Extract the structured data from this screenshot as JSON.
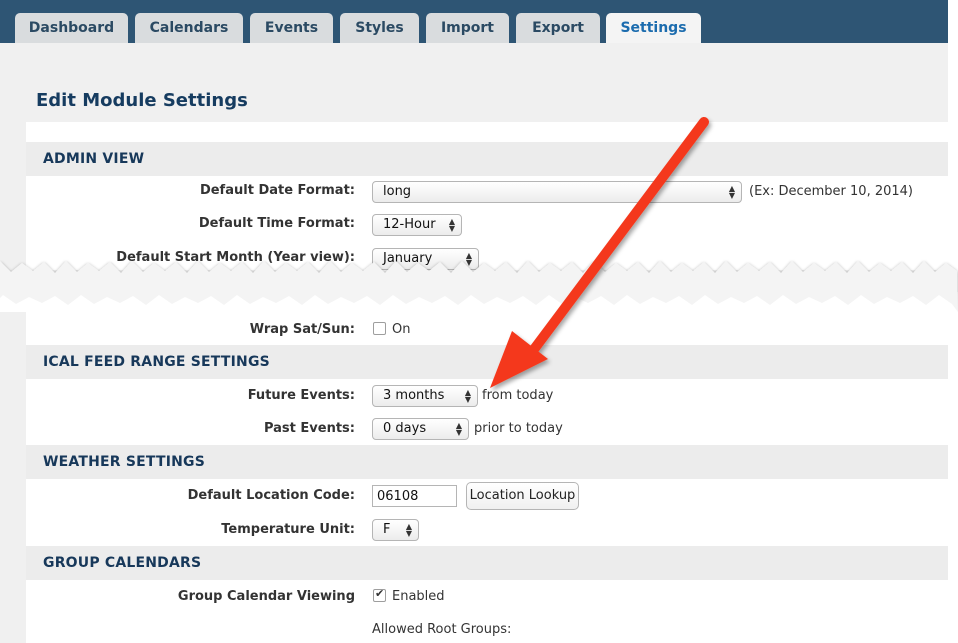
{
  "tabs": [
    {
      "label": "Dashboard",
      "active": false
    },
    {
      "label": "Calendars",
      "active": false
    },
    {
      "label": "Events",
      "active": false
    },
    {
      "label": "Styles",
      "active": false
    },
    {
      "label": "Import",
      "active": false
    },
    {
      "label": "Export",
      "active": false
    },
    {
      "label": "Settings",
      "active": true
    }
  ],
  "page_title": "Edit Module Settings",
  "admin_view": {
    "title": "ADMIN VIEW",
    "date_format_label": "Default Date Format:",
    "date_format_value": "long",
    "date_format_hint": "(Ex: December 10, 2014)",
    "time_format_label": "Default Time Format:",
    "time_format_value": "12-Hour",
    "start_month_label": "Default Start Month (Year view):",
    "start_month_value": "January",
    "wrap_label": "Wrap Sat/Sun:",
    "wrap_option": "On",
    "wrap_checked": false
  },
  "ical": {
    "title": "ICAL FEED RANGE SETTINGS",
    "future_label": "Future Events:",
    "future_value": "3 months",
    "future_hint": "from today",
    "past_label": "Past Events:",
    "past_value": "0 days",
    "past_hint": "prior to today"
  },
  "weather": {
    "title": "WEATHER SETTINGS",
    "location_label": "Default Location Code:",
    "location_value": "06108",
    "lookup_button": "Location Lookup",
    "temp_label": "Temperature Unit:",
    "temp_value": "F"
  },
  "groups": {
    "title": "GROUP CALENDARS",
    "viewing_label": "Group Calendar Viewing",
    "viewing_option": "Enabled",
    "viewing_checked": true,
    "allowed_label": "Allowed Root Groups:"
  },
  "colors": {
    "tabbar": "#2e5574",
    "active_tab_text": "#1c6cae",
    "heading": "#17385a",
    "annotation_arrow": "#f4391d"
  }
}
